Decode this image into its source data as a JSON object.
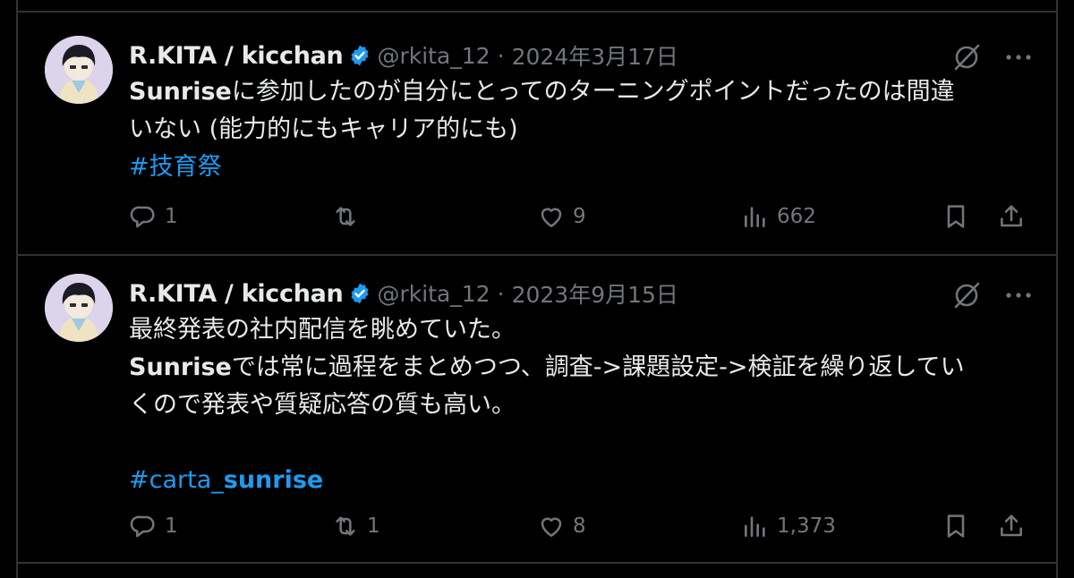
{
  "tweets": [
    {
      "display_name": "R.KITA / kicchan",
      "handle": "@rkita_12",
      "separator": "·",
      "date": "2024年3月17日",
      "text_line1_bold": "Sunrise",
      "text_line1_rest": "に参加したのが自分にとってのターニングポイントだったのは間違",
      "text_line2": "いない (能力的にもキャリア的にも)",
      "hashtag": "#技育祭",
      "reply_count": "1",
      "retweet_count": "",
      "like_count": "9",
      "view_count": "662"
    },
    {
      "display_name": "R.KITA / kicchan",
      "handle": "@rkita_12",
      "separator": "·",
      "date": "2023年9月15日",
      "text_line1": "最終発表の社内配信を眺めていた。",
      "text_line2_bold": "Sunrise",
      "text_line2_rest": "では常に過程をまとめつつ、調査->課題設定->検証を繰り返してい",
      "text_line3": "くので発表や質疑応答の質も高い。",
      "hashtag_prefix": "#carta_",
      "hashtag_bold": "sunrise",
      "reply_count": "1",
      "retweet_count": "1",
      "like_count": "8",
      "view_count": "1,373"
    }
  ],
  "icons": {
    "verified": "verified-badge-icon",
    "grok": "grok-icon",
    "more": "more-icon",
    "reply": "reply-icon",
    "retweet": "retweet-icon",
    "like": "like-icon",
    "views": "views-icon",
    "bookmark": "bookmark-icon",
    "share": "share-icon"
  },
  "colors": {
    "background": "#000000",
    "text": "#e7e9ea",
    "muted": "#71767b",
    "link": "#1d9bf0",
    "verified": "#1d9bf0",
    "divider": "#2f3336"
  }
}
